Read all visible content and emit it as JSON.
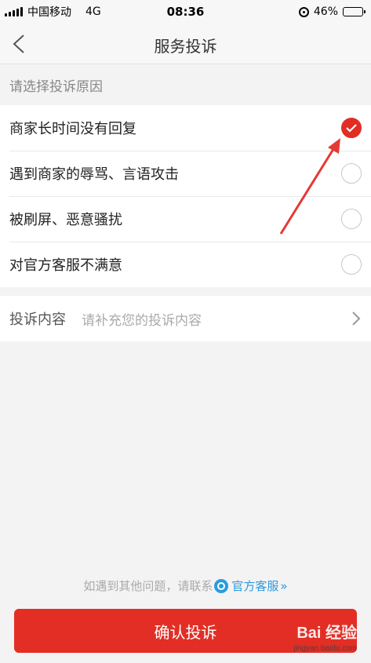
{
  "status_bar": {
    "carrier": "中国移动",
    "network": "4G",
    "time": "08:36",
    "battery_percent": "46%",
    "battery_level": 0.46
  },
  "nav": {
    "title": "服务投诉",
    "back_icon": "chevron-left-icon"
  },
  "reason_section_label": "请选择投诉原因",
  "reasons": [
    {
      "label": "商家长时间没有回复",
      "checked": true
    },
    {
      "label": "遇到商家的辱骂、言语攻击",
      "checked": false
    },
    {
      "label": "被刷屏、恶意骚扰",
      "checked": false
    },
    {
      "label": "对官方客服不满意",
      "checked": false
    }
  ],
  "complaint_content": {
    "label": "投诉内容",
    "placeholder": "请补充您的投诉内容"
  },
  "help": {
    "prefix": "如遇到其他问题，请联系",
    "link": "官方客服",
    "link_suffix": "»"
  },
  "confirm_button": "确认投诉",
  "watermark": {
    "main": "Bai 经验",
    "sub": "jingyan.baidu.com"
  },
  "colors": {
    "accent": "#e22e25",
    "link": "#2a9be0"
  }
}
